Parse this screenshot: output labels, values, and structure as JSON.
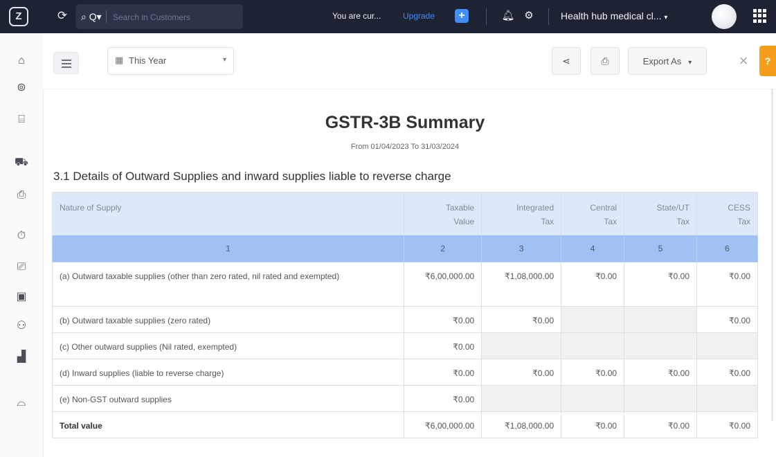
{
  "topbar": {
    "search_mode": "Q",
    "search_placeholder": "Search in Customers",
    "notice_text": "You are cur...",
    "upgrade_label": "Upgrade",
    "org_name": "Health hub medical cl...",
    "org_caret": "▾"
  },
  "toolbar": {
    "period_label": "This Year",
    "export_label": "Export As"
  },
  "report": {
    "title": "GSTR-3B Summary",
    "period": "From 01/04/2023  To 31/03/2024",
    "section_heading": "3.1 Details of Outward Supplies and inward supplies liable to reverse charge",
    "columns": [
      {
        "l1": "Nature of Supply",
        "l2": ""
      },
      {
        "l1": "Taxable",
        "l2": "Value"
      },
      {
        "l1": "Integrated",
        "l2": "Tax"
      },
      {
        "l1": "Central",
        "l2": "Tax"
      },
      {
        "l1": "State/UT",
        "l2": "Tax"
      },
      {
        "l1": "CESS",
        "l2": "Tax"
      }
    ],
    "column_numbers": [
      "1",
      "2",
      "3",
      "4",
      "5",
      "6"
    ],
    "rows": [
      {
        "label": "(a) Outward taxable supplies (other than zero rated, nil rated and exempted)",
        "taxable": "₹6,00,000.00",
        "igst": "₹1,08,000.00",
        "cgst": "₹0.00",
        "sgst": "₹0.00",
        "cess": "₹0.00"
      },
      {
        "label": "(b) Outward taxable supplies (zero rated)",
        "taxable": "₹0.00",
        "igst": "₹0.00",
        "cgst": "",
        "sgst": "",
        "cess": "₹0.00"
      },
      {
        "label": "(c) Other outward supplies (Nil rated, exempted)",
        "taxable": "₹0.00",
        "igst": "",
        "cgst": "",
        "sgst": "",
        "cess": ""
      },
      {
        "label": "(d) Inward supplies (liable to reverse charge)",
        "taxable": "₹0.00",
        "igst": "₹0.00",
        "cgst": "₹0.00",
        "sgst": "₹0.00",
        "cess": "₹0.00"
      },
      {
        "label": "(e) Non-GST outward supplies",
        "taxable": "₹0.00",
        "igst": "",
        "cgst": "",
        "sgst": "",
        "cess": ""
      }
    ],
    "total": {
      "label": "Total value",
      "taxable": "₹6,00,000.00",
      "igst": "₹1,08,000.00",
      "cgst": "₹0.00",
      "sgst": "₹0.00",
      "cess": "₹0.00"
    }
  },
  "colors": {
    "topbar_bg": "#1d2333",
    "upgrade_link": "#3f8cff",
    "header_row_bg": "#dce9fb",
    "number_row_bg": "#9fc1f3",
    "help_tab": "#f59e1b"
  }
}
